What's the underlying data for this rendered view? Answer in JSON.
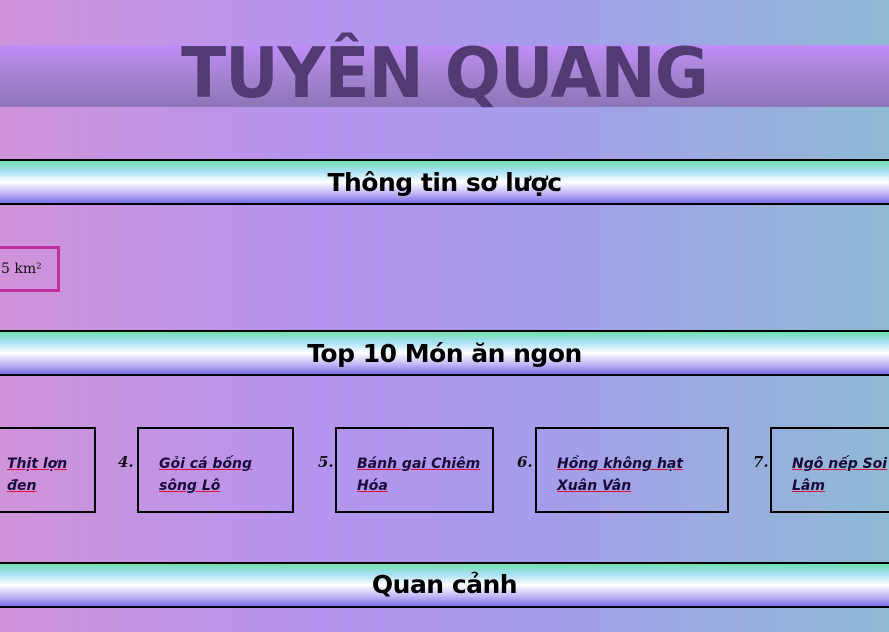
{
  "header": {
    "title": "TUYÊN QUANG"
  },
  "sections": {
    "overview_title": "Thông tin sơ lược",
    "food_title": "Top 10 Món ăn ngon",
    "scenery_title": "Quan cảnh"
  },
  "overview": {
    "area_text": "5 km²"
  },
  "foods": [
    {
      "number": "",
      "name": "Thịt lợn đen"
    },
    {
      "number": "4.",
      "name": "Gỏi cá bống sông Lô"
    },
    {
      "number": "5.",
      "name": "Bánh gai Chiêm Hóa"
    },
    {
      "number": "6.",
      "name": "Hồng không hạt Xuân Vân"
    },
    {
      "number": "7.",
      "name": "Ngô nếp Soi Lâm"
    }
  ],
  "colors": {
    "title_text": "#523a72",
    "area_border": "#c02fa0",
    "link_underline": "#e0103a"
  }
}
